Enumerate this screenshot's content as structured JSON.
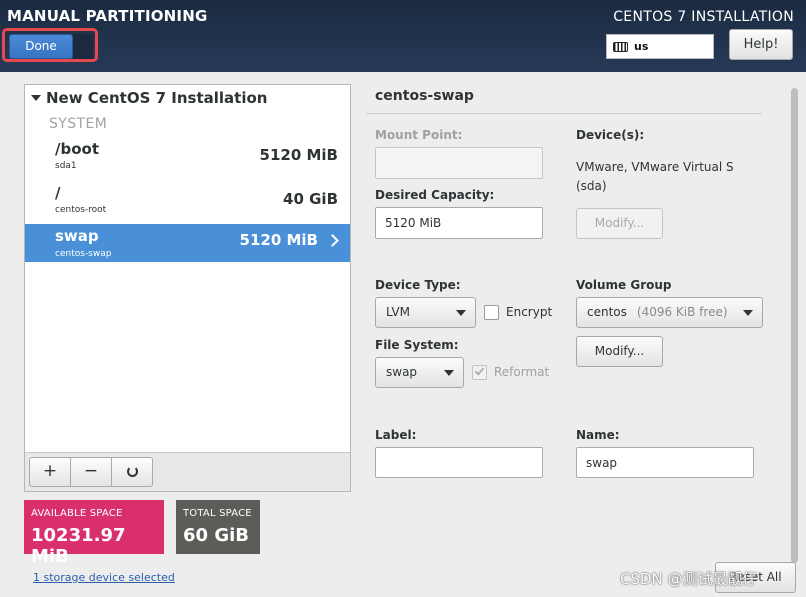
{
  "header": {
    "page_title": "MANUAL PARTITIONING",
    "done_label": "Done",
    "install_title": "CENTOS 7 INSTALLATION",
    "keyboard_layout": "us",
    "help_label": "Help!"
  },
  "partitions": {
    "group_title": "New CentOS 7 Installation",
    "section_label": "SYSTEM",
    "items": [
      {
        "mount": "/boot",
        "device": "sda1",
        "size": "5120 MiB"
      },
      {
        "mount": "/",
        "device": "centos-root",
        "size": "40 GiB"
      },
      {
        "mount": "swap",
        "device": "centos-swap",
        "size": "5120 MiB",
        "selected": true
      }
    ],
    "toolbar": {
      "add": "+",
      "remove": "−"
    }
  },
  "space": {
    "available_label": "AVAILABLE SPACE",
    "available_value": "10231.97 MiB",
    "total_label": "TOTAL SPACE",
    "total_value": "60 GiB"
  },
  "storage_link": "1 storage device selected",
  "detail": {
    "title": "centos-swap",
    "mount_point_label": "Mount Point:",
    "mount_point_value": "",
    "desired_capacity_label": "Desired Capacity:",
    "desired_capacity_value": "5120 MiB",
    "devices_label": "Device(s):",
    "devices_line1": "VMware, VMware Virtual S",
    "devices_line2": "(sda)",
    "modify_label": "Modify...",
    "device_type_label": "Device Type:",
    "device_type_value": "LVM",
    "encrypt_label": "Encrypt",
    "volume_group_label": "Volume Group",
    "volume_group_value": "centos",
    "volume_group_free": "(4096 KiB free)",
    "volume_modify_label": "Modify...",
    "file_system_label": "File System:",
    "file_system_value": "swap",
    "reformat_label": "Reformat",
    "label_label": "Label:",
    "label_value": "",
    "name_label": "Name:",
    "name_value": "swap"
  },
  "reset_label": "Reset All",
  "watermark": "CSDN @测试最靓仔",
  "colors": {
    "header_bg": "#1b2a40",
    "selected_row": "#4a90d9",
    "available_space": "#d9306d",
    "total_space": "#5e5c58",
    "done_highlight": "#e5484d"
  }
}
